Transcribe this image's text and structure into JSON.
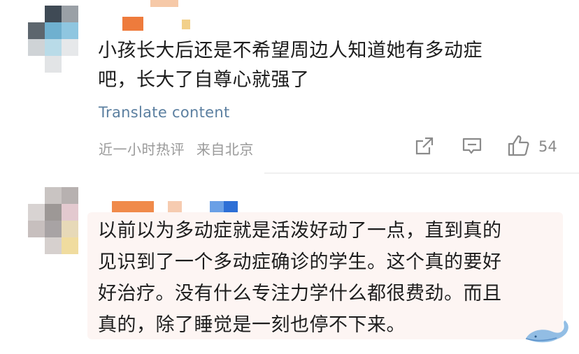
{
  "comments": [
    {
      "text": "小孩长大后还是不希望周边人知道她有多动症\n吧，长大了自尊心就强了",
      "translate_label": "Translate content",
      "time_label": "近一小时热评",
      "location_label": "来自北京",
      "like_count": "54"
    },
    {
      "text": "以前以为多动症就是活泼好动了一点，直到真的\n见识到了一个多动症确诊的学生。这个真的要好\n好治疗。没有什么专注力学什么都很费劲。而且\n真的，除了睡觉是一刻也停不下来。"
    }
  ],
  "icons": {
    "share": "share-icon",
    "reply": "comment-icon",
    "like": "thumbs-up-icon",
    "watermark": "whale-icon"
  },
  "colors": {
    "link": "#5b7fa0",
    "meta": "#9a9a9a",
    "highlight_bg": "#fdf5f3"
  }
}
